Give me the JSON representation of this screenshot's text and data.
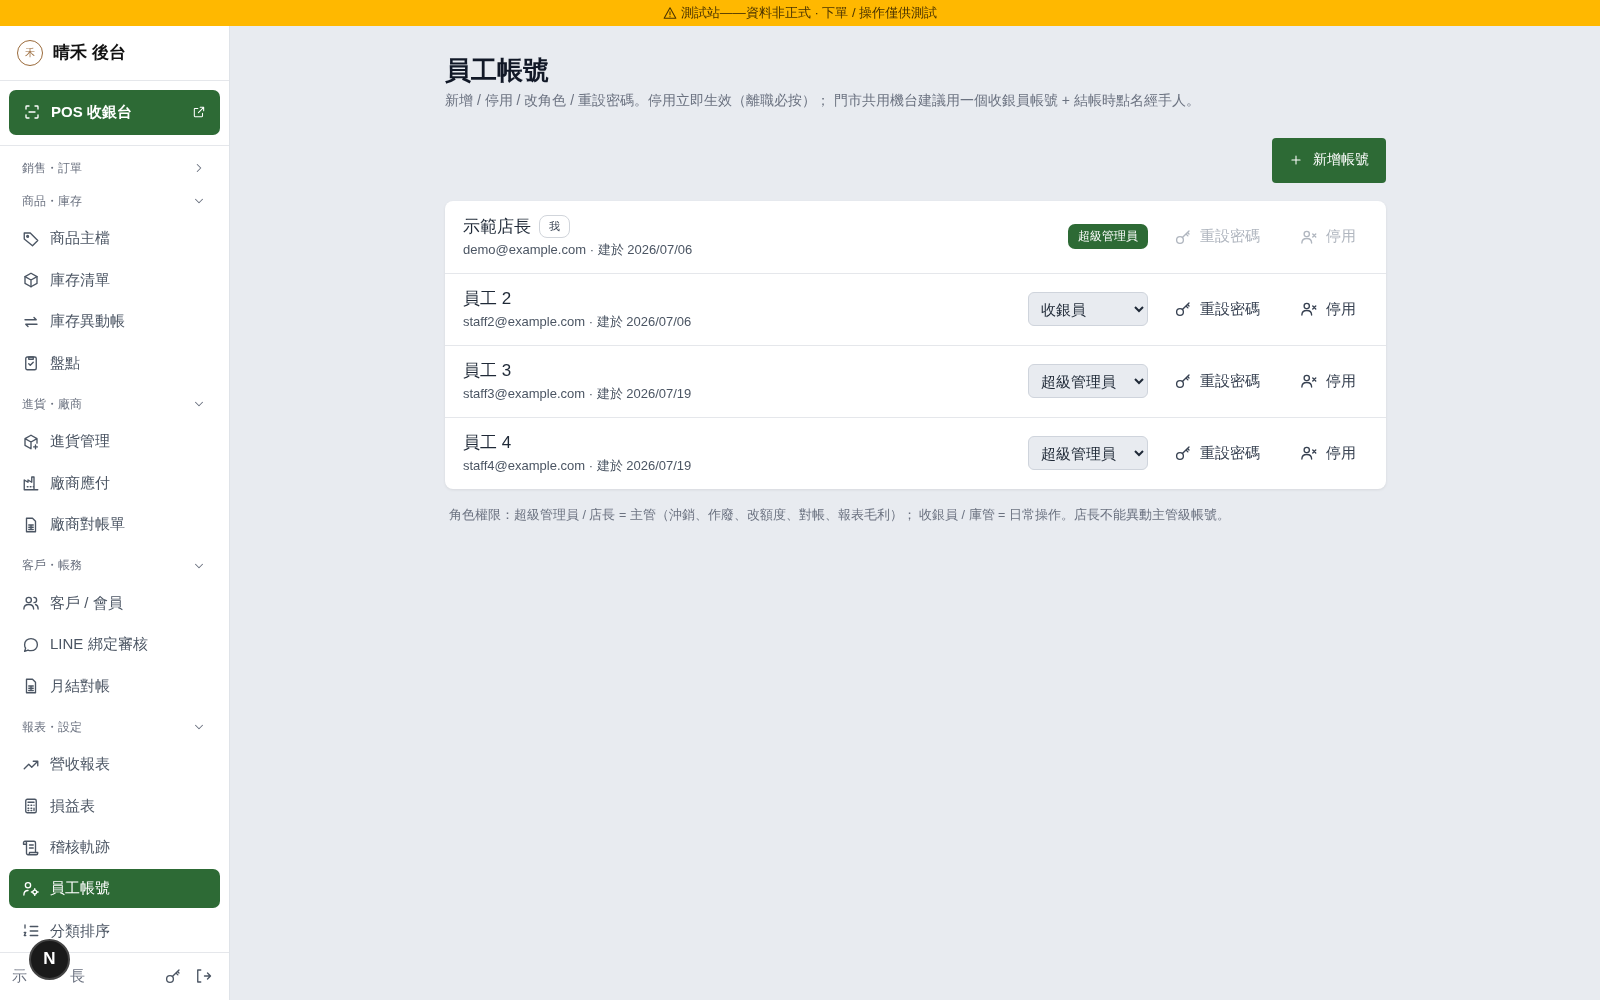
{
  "banner": {
    "text": "測試站——資料非正式 · 下單 / 操作僅供測試"
  },
  "sidebar": {
    "brand": {
      "logo": "禾",
      "title": "晴禾 後台"
    },
    "pos_button": {
      "label": "POS 收銀台"
    },
    "sections": [
      {
        "label": "銷售・訂單",
        "expanded": false
      },
      {
        "label": "商品・庫存",
        "expanded": true,
        "items": [
          {
            "label": "商品主檔",
            "selected": false
          },
          {
            "label": "庫存清單",
            "selected": false
          },
          {
            "label": "庫存異動帳",
            "selected": false
          },
          {
            "label": "盤點",
            "selected": false
          }
        ]
      },
      {
        "label": "進貨・廠商",
        "expanded": true,
        "items": [
          {
            "label": "進貨管理",
            "selected": false
          },
          {
            "label": "廠商應付",
            "selected": false
          },
          {
            "label": "廠商對帳單",
            "selected": false
          }
        ]
      },
      {
        "label": "客戶・帳務",
        "expanded": true,
        "items": [
          {
            "label": "客戶 / 會員",
            "selected": false
          },
          {
            "label": "LINE 綁定審核",
            "selected": false
          },
          {
            "label": "月結對帳",
            "selected": false
          }
        ]
      },
      {
        "label": "報表・設定",
        "expanded": true,
        "items": [
          {
            "label": "營收報表",
            "selected": false
          },
          {
            "label": "損益表",
            "selected": false
          },
          {
            "label": "稽核軌跡",
            "selected": false
          },
          {
            "label": "員工帳號",
            "selected": true
          },
          {
            "label": "分類排序",
            "selected": false
          }
        ]
      }
    ],
    "footer": {
      "user_visible_parts": [
        "示",
        "長"
      ],
      "dev_badge": "N"
    }
  },
  "page": {
    "title": "員工帳號",
    "subtitle": "新增 / 停用 / 改角色 / 重設密碼。停用立即生效（離職必按）； 門市共用機台建議用一個收銀員帳號 + 結帳時點名經手人。",
    "add_button": "新增帳號",
    "accounts": [
      {
        "name": "示範店長",
        "me_tag": "我",
        "meta": "demo@example.com · 建於 2026/07/06",
        "kind": "badge",
        "role": "超級管理員",
        "reset": "重設密碼",
        "deactivate": "停用",
        "disabled": true
      },
      {
        "name": "員工 2",
        "meta": "staff2@example.com · 建於 2026/07/06",
        "kind": "select",
        "role": "收銀員",
        "reset": "重設密碼",
        "deactivate": "停用",
        "disabled": false
      },
      {
        "name": "員工 3",
        "meta": "staff3@example.com · 建於 2026/07/19",
        "kind": "select",
        "role": "超級管理員",
        "reset": "重設密碼",
        "deactivate": "停用",
        "disabled": false
      },
      {
        "name": "員工 4",
        "meta": "staff4@example.com · 建於 2026/07/19",
        "kind": "select",
        "role": "超級管理員",
        "reset": "重設密碼",
        "deactivate": "停用",
        "disabled": false
      }
    ],
    "note": "角色權限：超級管理員 / 店長 = 主管（沖銷、作廢、改額度、對帳、報表毛利）； 收銀員 / 庫管 = 日常操作。店長不能異動主管級帳號。"
  }
}
